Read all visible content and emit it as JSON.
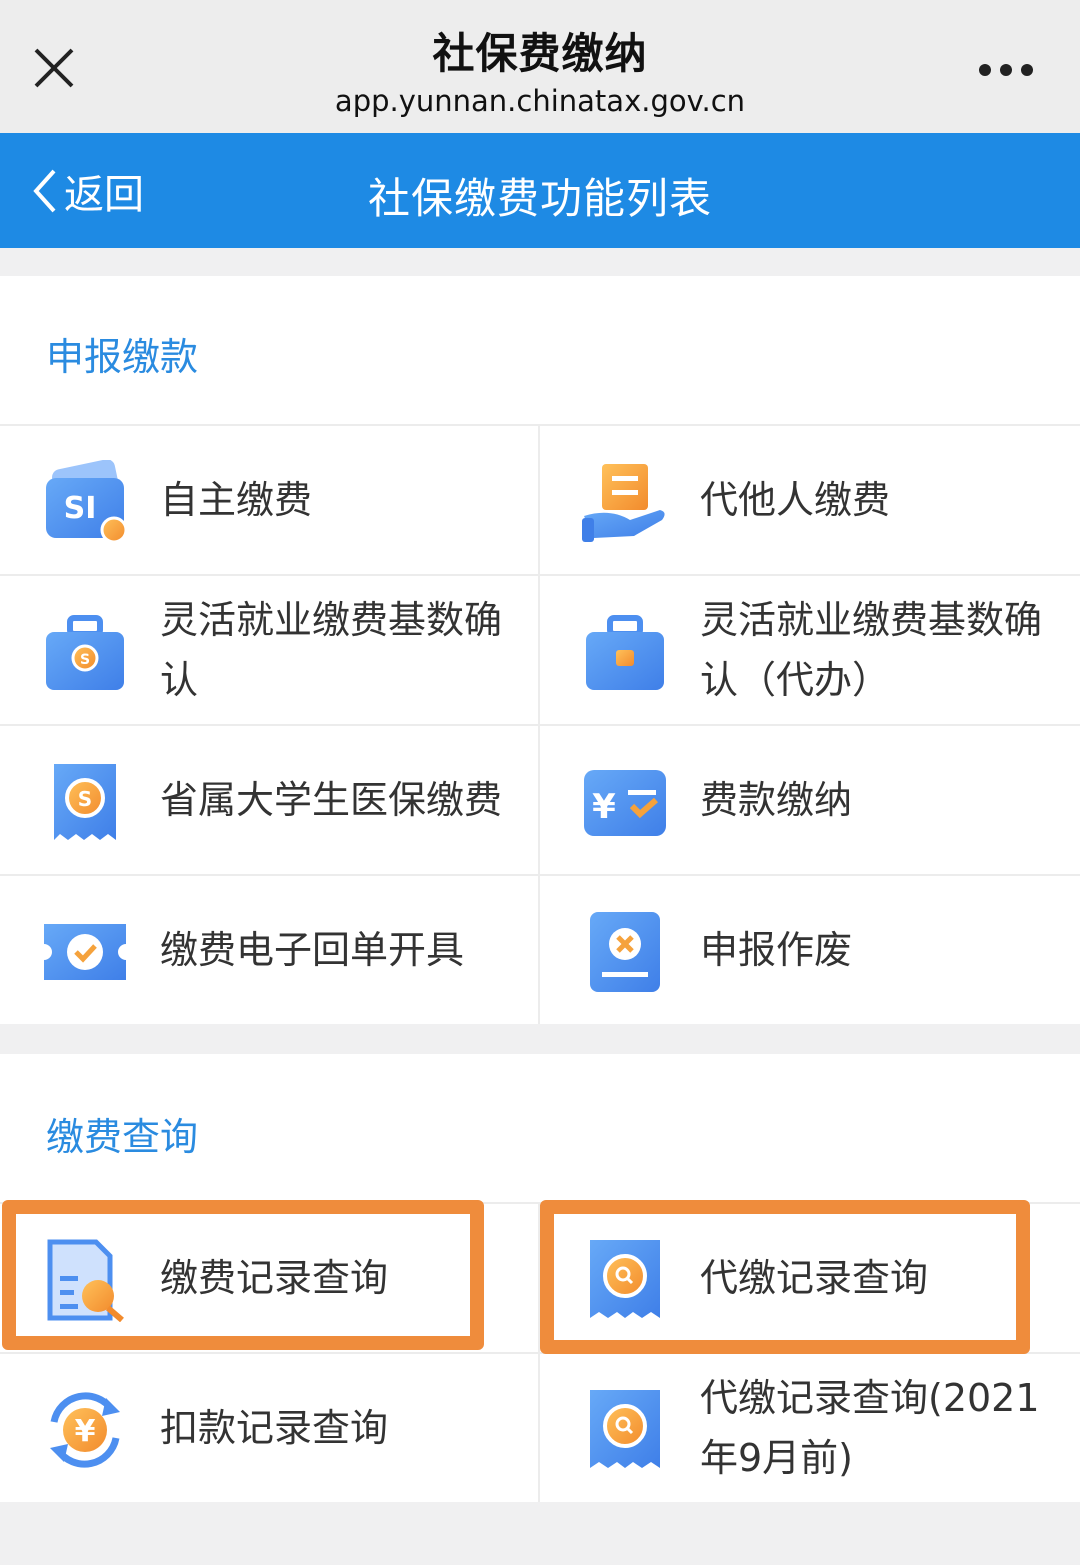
{
  "topbar": {
    "title": "社保费缴纳",
    "url": "app.yunnan.chinatax.gov.cn"
  },
  "navbar": {
    "back_label": "返回",
    "title": "社保缴费功能列表"
  },
  "sections": [
    {
      "title": "申报缴款",
      "items": [
        {
          "label": "自主缴费",
          "icon": "social-security-card-icon"
        },
        {
          "label": "代他人缴费",
          "icon": "hand-document-icon"
        },
        {
          "label": "灵活就业缴费基数确认",
          "icon": "briefcase-icon"
        },
        {
          "label": "灵活就业缴费基数确认（代办）",
          "icon": "briefcase-icon"
        },
        {
          "label": "省属大学生医保缴费",
          "icon": "receipt-icon"
        },
        {
          "label": "费款缴纳",
          "icon": "yuan-check-icon"
        },
        {
          "label": "缴费电子回单开具",
          "icon": "ticket-check-icon"
        },
        {
          "label": "申报作废",
          "icon": "cancel-document-icon"
        }
      ]
    },
    {
      "title": "缴费查询",
      "items": [
        {
          "label": "缴费记录查询",
          "icon": "document-search-icon"
        },
        {
          "label": "代缴记录查询",
          "icon": "receipt-search-icon"
        },
        {
          "label": "扣款记录查询",
          "icon": "yuan-refresh-icon"
        },
        {
          "label": "代缴记录查询(2021年9月前)",
          "icon": "receipt-search-icon"
        }
      ]
    }
  ],
  "colors": {
    "navbar": "#1e8ae4",
    "section_title": "#2a8be0",
    "highlight": "#ef8c3c",
    "icon_blue": "#4d8ff0",
    "icon_orange": "#f5a23c"
  }
}
